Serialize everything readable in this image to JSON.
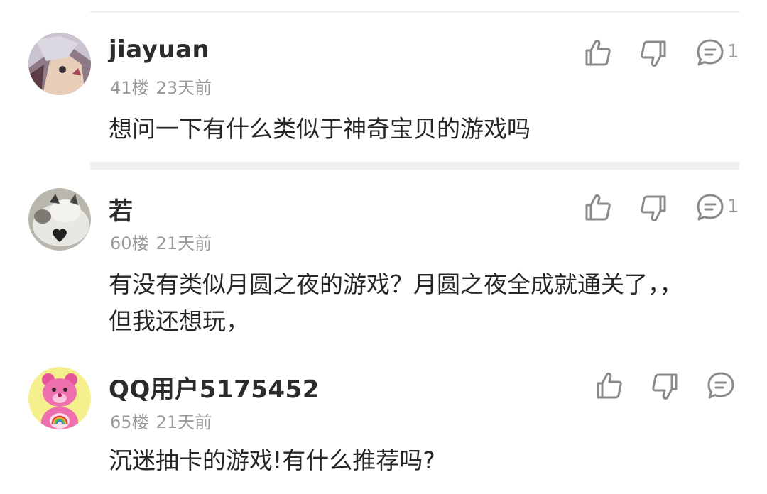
{
  "comments": [
    {
      "username": "jiayuan",
      "floor": "41楼",
      "time": "23天前",
      "text": "想问一下有什么类似于神奇宝贝的游戏吗",
      "reply_count": "1",
      "avatar_icon": "anime-avatar-icon"
    },
    {
      "username": "若",
      "floor": "60楼",
      "time": "21天前",
      "text": "有没有类似月圆之夜的游戏？月圆之夜全成就通关了，，但我还想玩，",
      "reply_count": "1",
      "avatar_icon": "cat-avatar-icon"
    },
    {
      "username": "QQ用户5175452",
      "floor": "65楼",
      "time": "21天前",
      "text": "沉迷抽卡的游戏!有什么推荐吗?",
      "reply_count": "",
      "avatar_icon": "care-bear-avatar-icon"
    }
  ],
  "icons": {
    "like": "thumbs-up-icon",
    "dislike": "thumbs-down-icon",
    "reply": "comment-bubble-icon"
  },
  "colors": {
    "icon_gray": "#8a8a8a",
    "meta_gray": "#9a9a9a",
    "divider": "#f0f0f0"
  }
}
